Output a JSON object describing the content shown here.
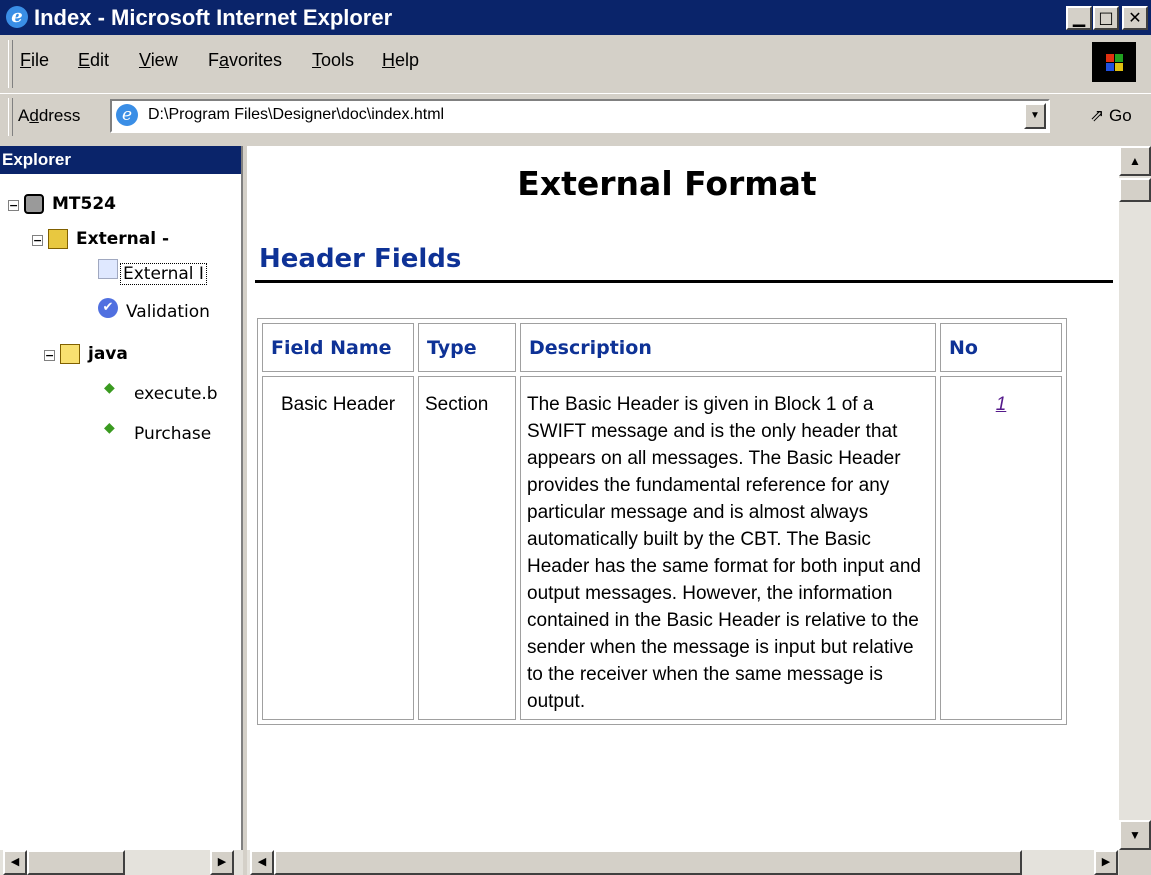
{
  "window": {
    "title": "Index - Microsoft Internet Explorer",
    "controls": [
      "minimize-icon",
      "maximize-icon",
      "close-icon"
    ]
  },
  "menu": {
    "items": [
      {
        "label": "File",
        "accel": "F",
        "rest": "ile"
      },
      {
        "label": "Edit",
        "accel": "E",
        "rest": "dit"
      },
      {
        "label": "View",
        "accel": "V",
        "rest": "iew"
      },
      {
        "label": "Favorites",
        "pre": "F",
        "accel": "a",
        "rest": "vorites"
      },
      {
        "label": "Tools",
        "accel": "T",
        "rest": "ools"
      },
      {
        "label": "Help",
        "accel": "H",
        "rest": "elp"
      }
    ]
  },
  "address": {
    "label_pre": "A",
    "label_accel": "d",
    "label_rest": "dress",
    "value": "D:\\Program Files\\Designer\\doc\\index.html",
    "go_label": "Go"
  },
  "explorer": {
    "header": "Explorer",
    "tree": [
      {
        "label": "MT524",
        "icon": "database-icon",
        "expander": "⊟",
        "bold": true
      },
      {
        "label": "External -",
        "icon": "gear-folder-icon",
        "expander": "⊟",
        "bold": true
      },
      {
        "label": "External I",
        "icon": "envelope-icon",
        "selected": true
      },
      {
        "label": "Validation",
        "icon": "check-circle-icon"
      },
      {
        "label": "java",
        "icon": "folder-icon",
        "expander": "⊟",
        "bold": true
      },
      {
        "label": "execute.b",
        "icon": "diamond-icon"
      },
      {
        "label": "Purchase",
        "icon": "diamond-icon"
      }
    ]
  },
  "page": {
    "title": "External Format",
    "section_heading": "Header Fields",
    "table": {
      "headers": [
        "Field Name",
        "Type",
        "Description",
        "No"
      ],
      "rows": [
        {
          "field_name": "Basic Header",
          "type": "Section",
          "description": "The Basic Header is given in Block 1 of a SWIFT message and is the only header that appears on all messages. The Basic Header provides the fundamental reference for any particular message and is almost always automatically built by the CBT. The Basic Header has the same format for both input and output messages. However, the information contained in the Basic Header is relative to the sender when the message is input but relative to the receiver when the same message is output.",
          "no": "1"
        }
      ]
    }
  },
  "colors": {
    "titlebar": "#0a246a",
    "heading_blue": "#0e3296",
    "chrome": "#d4d0c8",
    "visited_link": "#551a8b"
  }
}
